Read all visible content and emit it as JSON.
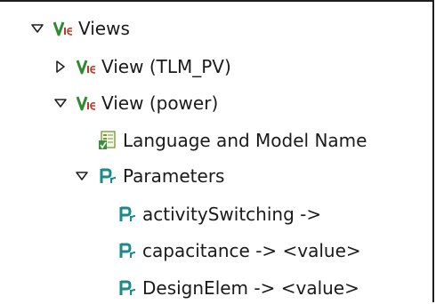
{
  "tree": {
    "root": {
      "label": "Views",
      "icon": "views-icon",
      "expanded": true
    },
    "view_tlm": {
      "label": "View (TLM_PV)",
      "icon": "view-icon",
      "expanded": false
    },
    "view_power": {
      "label": "View (power)",
      "icon": "view-icon",
      "expanded": true
    },
    "language": {
      "label": "Language and Model Name",
      "icon": "language-model-icon"
    },
    "parameters": {
      "label": "Parameters",
      "icon": "parameters-icon",
      "expanded": true
    },
    "param_activity": {
      "label": "activitySwitching ->",
      "icon": "parameter-icon"
    },
    "param_capacitance": {
      "label": "capacitance -> <value>",
      "icon": "parameter-icon"
    },
    "param_designelem": {
      "label": "DesignElem -> <value>",
      "icon": "parameter-icon"
    }
  },
  "colors": {
    "view_icon_green": "#2e8b2e",
    "view_icon_red": "#c0392b",
    "param_icon_teal": "#1a8a8a",
    "twisty": "#222222"
  }
}
